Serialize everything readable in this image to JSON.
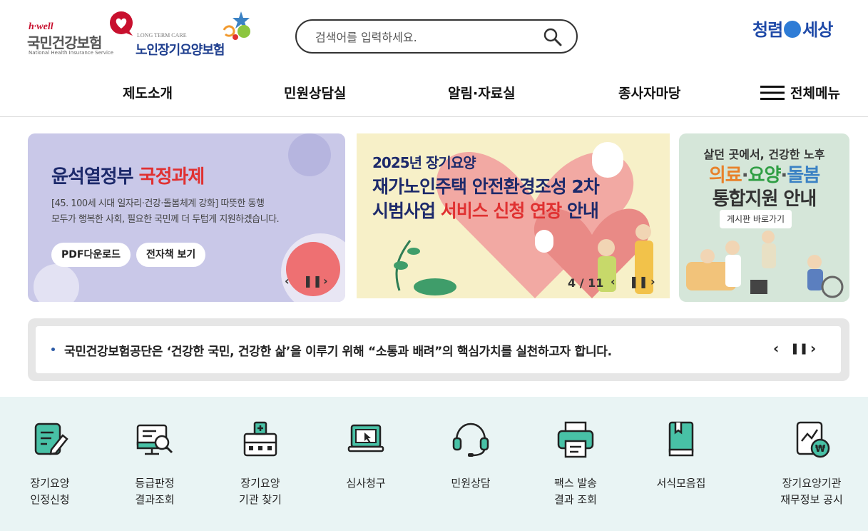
{
  "header": {
    "nhis_logo": {
      "tagline": "h·well",
      "name": "국민건강보험",
      "sub": "National Health Insurance Service"
    },
    "ltc_logo": {
      "en": "LONG TERM CARE",
      "ko": "노인장기요양보험"
    },
    "search": {
      "placeholder": "검색어를 입력하세요.",
      "icon": "search-icon"
    },
    "campaign": {
      "left": "청렴",
      "center": "靑",
      "right": "세상"
    }
  },
  "gnb": {
    "items": [
      "제도소개",
      "민원상담실",
      "알림·자료실",
      "종사자마당"
    ],
    "all_menu": "전체메뉴"
  },
  "banners": {
    "gov": {
      "title_a": "윤석열정부 ",
      "title_b": "국정과제",
      "desc1": "[45. 100세 시대 일자리·건강·돌봄체계 강화] 따뜻한 동행",
      "desc2": "모두가 행복한 사회, 필요한 국민께 더 두텁게 지원하겠습니다.",
      "btn_pdf": "PDF다운로드",
      "btn_ebook": "전자책 보기"
    },
    "main": {
      "line1": "2025년 장기요양",
      "line2": "재가노인주택 안전환경조성 2차",
      "line3_a": "시범사업 ",
      "line3_b": "서비스 신청 연장",
      "line3_c": " 안내",
      "pager_current": "4",
      "pager_sep": " / ",
      "pager_total": "11"
    },
    "side": {
      "line1": "살던 곳에서, 건강한 노후",
      "w1": "의료",
      "w2": "요양",
      "w3": "돌봄",
      "dot": "·",
      "line3": "통합지원 안내",
      "link": "게시판 바로가기"
    }
  },
  "notice": {
    "text": "국민건강보험공단은 ‘건강한 국민, 건강한 삶’을 이루기 위해 “소통과 배려”의 핵심가치를 실천하고자 합니다."
  },
  "quick_menu": [
    {
      "label": "장기요양\n인정신청",
      "icon": "application-form-icon"
    },
    {
      "label": "등급판정\n결과조회",
      "icon": "grade-result-search-icon"
    },
    {
      "label": "장기요양\n기관 찾기",
      "icon": "care-facility-icon"
    },
    {
      "label": "심사청구",
      "icon": "laptop-claim-icon"
    },
    {
      "label": "민원상담",
      "icon": "headset-icon"
    },
    {
      "label": "팩스 발송\n결과 조회",
      "icon": "fax-icon"
    },
    {
      "label": "서식모음집",
      "icon": "form-book-icon"
    },
    {
      "label": "장기요양기관\n재무정보 공시",
      "icon": "financial-disclosure-icon"
    }
  ],
  "colors": {
    "accent_teal": "#48c1a6",
    "brand_navy": "#1d2a6b",
    "highlight_red": "#e03131"
  }
}
